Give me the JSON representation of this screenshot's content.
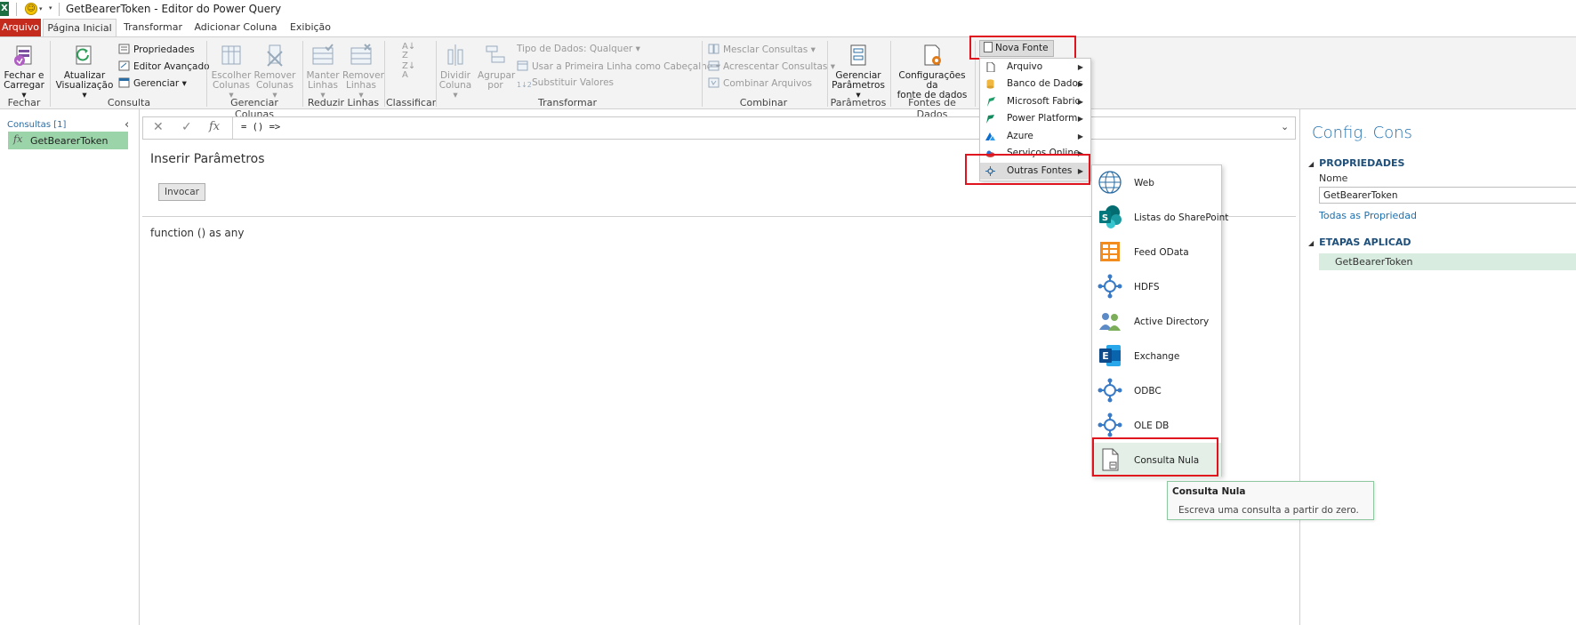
{
  "window": {
    "title": "GetBearerToken - Editor do Power Query",
    "app_icon": "X"
  },
  "tabs": [
    "Arquivo",
    "Página Inicial",
    "Transformar",
    "Adicionar Coluna",
    "Exibição"
  ],
  "ribbon": {
    "groups": {
      "fechar": "Fechar",
      "consulta": "Consulta",
      "gerenciar_colunas": "Gerenciar Colunas",
      "reduzir_linhas": "Reduzir Linhas",
      "classificar": "Classificar",
      "transformar": "Transformar",
      "combinar": "Combinar",
      "parametros": "Parâmetros",
      "fontes_dados": "Fontes de Dados"
    },
    "fechar_carregar": [
      "Fechar e",
      "Carregar"
    ],
    "atualizar": [
      "Atualizar",
      "Visualização"
    ],
    "propriedades": "Propriedades",
    "editor_avancado": "Editor Avançado",
    "gerenciar": "Gerenciar",
    "escolher_colunas": [
      "Escolher",
      "Colunas"
    ],
    "remover_colunas": [
      "Remover",
      "Colunas"
    ],
    "manter_linhas": [
      "Manter",
      "Linhas"
    ],
    "remover_linhas": [
      "Remover",
      "Linhas"
    ],
    "dividir_coluna": [
      "Dividir",
      "Coluna"
    ],
    "agrupar_por": [
      "Agrupar",
      "por"
    ],
    "tipo_dados": "Tipo de Dados: Qualquer",
    "primeira_linha": "Usar a Primeira Linha como Cabeçalho",
    "substituir": "Substituir Valores",
    "mesclar": "Mesclar Consultas",
    "acrescentar": "Acrescentar Consultas",
    "combinar_arquivos": "Combinar Arquivos",
    "gerenciar_parametros": [
      "Gerenciar",
      "Parâmetros"
    ],
    "config_fonte": [
      "Configurações da",
      "fonte de dados"
    ],
    "nova_fonte": "Nova Fonte"
  },
  "queries": {
    "header": "Consultas [1]",
    "items": [
      {
        "label": "GetBearerToken",
        "icon": "fx"
      }
    ]
  },
  "formula": {
    "text": "= () =>"
  },
  "main": {
    "title": "Inserir Parâmetros",
    "invoke_label": "Invocar",
    "signature": "function () as any"
  },
  "settings": {
    "title": "Config. Cons",
    "properties_header": "PROPRIEDADES",
    "name_label": "Nome",
    "name_value": "GetBearerToken",
    "all_props_link": "Todas as Propriedad",
    "steps_header": "ETAPAS APLICAD",
    "step": "GetBearerToken"
  },
  "nova_fonte_menu": [
    {
      "label": "Arquivo",
      "icon": "file-icon"
    },
    {
      "label": "Banco de Dados",
      "icon": "database-icon"
    },
    {
      "label": "Microsoft Fabric",
      "icon": "fabric-icon"
    },
    {
      "label": "Power Platform",
      "icon": "power-platform-icon"
    },
    {
      "label": "Azure",
      "icon": "azure-icon"
    },
    {
      "label": "Serviços Online",
      "icon": "cloud-icon"
    },
    {
      "label": "Outras Fontes",
      "icon": "other-sources-icon"
    }
  ],
  "outras_fontes_menu": [
    {
      "label": "Web",
      "icon": "globe-icon"
    },
    {
      "label": "Listas do SharePoint",
      "icon": "sharepoint-icon"
    },
    {
      "label": "Feed OData",
      "icon": "odata-icon"
    },
    {
      "label": "HDFS",
      "icon": "connector-icon"
    },
    {
      "label": "Active Directory",
      "icon": "users-icon"
    },
    {
      "label": "Exchange",
      "icon": "exchange-icon"
    },
    {
      "label": "ODBC",
      "icon": "connector-icon"
    },
    {
      "label": "OLE DB",
      "icon": "connector-icon"
    },
    {
      "label": "Consulta Nula",
      "icon": "blank-query-icon"
    }
  ],
  "tooltip": {
    "title": "Consulta Nula",
    "description": "Escreva uma consulta a partir do zero."
  },
  "colors": {
    "file_tab": "#c42b1c",
    "query_selected": "#9bd4a9",
    "highlight_box": "#e0141e",
    "accent_blue": "#1e6fae",
    "excel_green": "#1d6f42"
  }
}
